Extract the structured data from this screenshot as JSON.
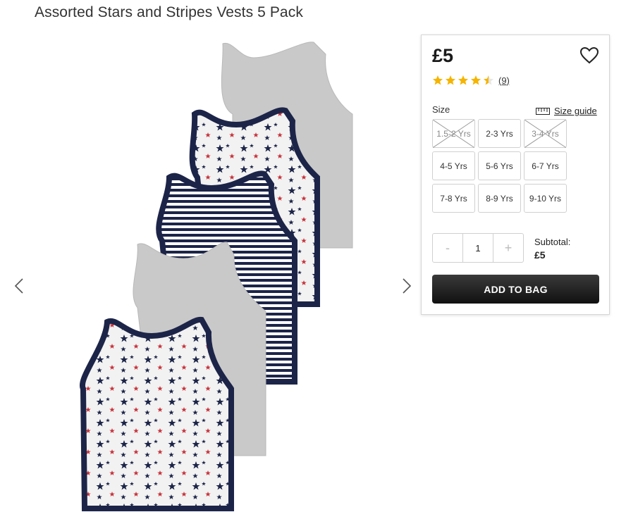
{
  "product": {
    "title": "Assorted Stars and Stripes Vests 5 Pack",
    "price": "£5",
    "rating": 4.5,
    "review_count": "(9)"
  },
  "icons": {
    "wishlist": "heart-outline-icon",
    "prev": "chevron-left-icon",
    "next": "chevron-right-icon",
    "size_guide": "ruler-icon",
    "star_color": "#f5b400"
  },
  "size": {
    "label": "Size",
    "guide_label": "Size guide",
    "options": [
      {
        "label": "1.5-2 Yrs",
        "available": false
      },
      {
        "label": "2-3 Yrs",
        "available": true
      },
      {
        "label": "3-4 Yrs",
        "available": false
      },
      {
        "label": "4-5 Yrs",
        "available": true
      },
      {
        "label": "5-6 Yrs",
        "available": true
      },
      {
        "label": "6-7 Yrs",
        "available": true
      },
      {
        "label": "7-8 Yrs",
        "available": true
      },
      {
        "label": "8-9 Yrs",
        "available": true
      },
      {
        "label": "9-10 Yrs",
        "available": true
      }
    ]
  },
  "quantity": {
    "minus": "-",
    "value": "1",
    "plus": "+"
  },
  "subtotal": {
    "label": "Subtotal:",
    "value": "£5"
  },
  "cta": {
    "add_to_bag": "ADD TO BAG"
  },
  "colors": {
    "navy": "#1c2448",
    "grey": "#c9c9c9",
    "red": "#c8303a"
  }
}
